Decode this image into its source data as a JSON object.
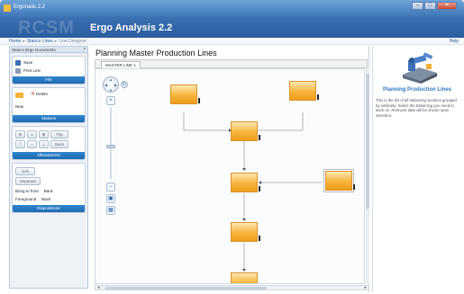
{
  "window": {
    "title": "Ergonalis 2.2"
  },
  "header": {
    "logo_text": "RCSM",
    "title": "Ergo Analysis 2.2"
  },
  "breadcrumb": {
    "items": [
      "Home",
      "Stanco Lines",
      "Line Designer"
    ],
    "help_label": "Help"
  },
  "left_panel": {
    "header": "Stanco Ergo Documents",
    "file_group": {
      "save_label": "Save",
      "print_label": "Print Line",
      "title": "File"
    },
    "stations_group": {
      "delete_label": "Delete",
      "new_label": "New",
      "title": "Stations"
    },
    "alignments_group": {
      "flip_label": "Flip",
      "back_label": "Back",
      "title": "Allineamento"
    },
    "dispositions_group": {
      "join_label": "Join",
      "separate_label": "Separate",
      "bring_front_label": "Bring to front",
      "back_label": "Back",
      "foreground_label": "Foreground",
      "back2_label": "Back",
      "title": "Disposizione"
    }
  },
  "main": {
    "title": "Planning Master Production Lines",
    "tab_label": "MASTER LINE 1"
  },
  "right_panel": {
    "title": "Planning Production Lines",
    "description": "This is the list of all balancing sections grouped by similarity. Select the balancing you need to work on. Relevant data will be shown upon selection."
  },
  "colors": {
    "accent": "#2b5d9f",
    "panel_bar": "#1f6ab0",
    "node_fill": "#f6b43b",
    "info_title": "#2f78c2"
  },
  "icons": [
    "save-icon",
    "print-icon",
    "station-icon",
    "delete-icon",
    "pan-icon",
    "zoom-in-icon",
    "zoom-out-icon",
    "fit-icon",
    "grid-icon",
    "robot-illustration"
  ]
}
